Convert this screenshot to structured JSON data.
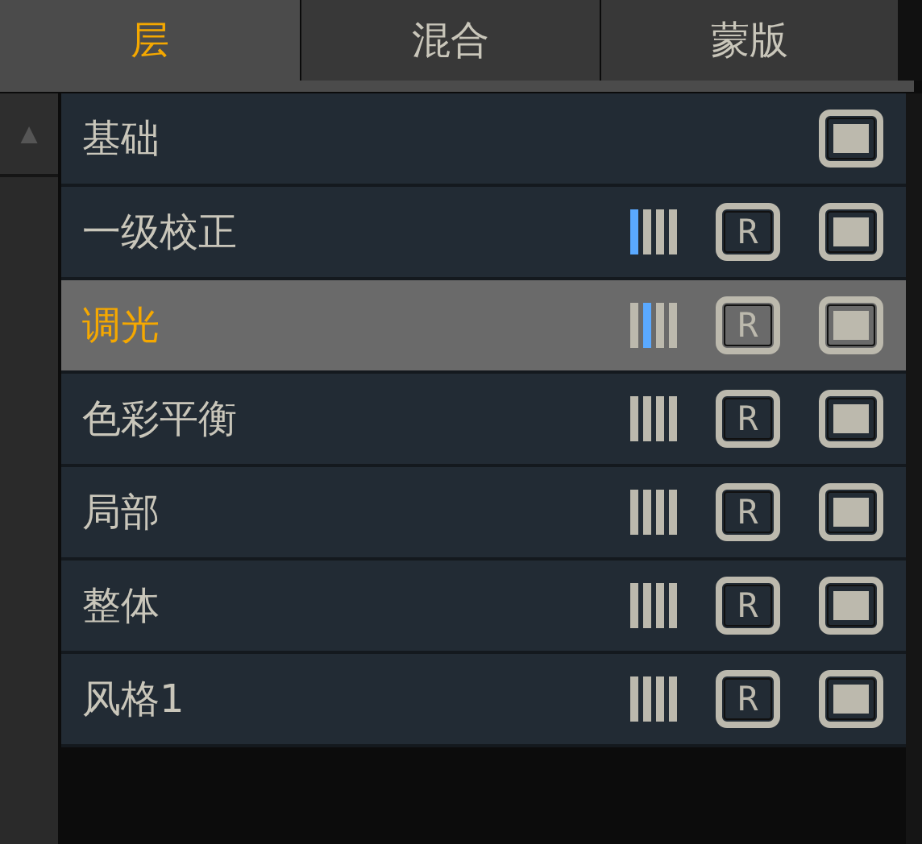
{
  "tabs": [
    {
      "label": "层",
      "selected": true
    },
    {
      "label": "混合",
      "selected": false
    },
    {
      "label": "蒙版",
      "selected": false
    }
  ],
  "scroll_up": "▲",
  "layers": [
    {
      "kind": "base",
      "name": "基础",
      "selected": false
    },
    {
      "kind": "layer",
      "name": "一级校正",
      "selected": false,
      "bars": [
        {
          "on": true
        },
        {
          "on": false
        },
        {
          "on": false
        },
        {
          "on": false
        }
      ],
      "r": "R"
    },
    {
      "kind": "layer",
      "name": "调光",
      "selected": true,
      "bars": [
        {
          "on": false
        },
        {
          "on": true
        },
        {
          "on": false
        },
        {
          "on": false
        }
      ],
      "r": "R"
    },
    {
      "kind": "layer",
      "name": "色彩平衡",
      "selected": false,
      "bars": [
        {
          "on": false
        },
        {
          "on": false
        },
        {
          "on": false
        },
        {
          "on": false
        }
      ],
      "r": "R"
    },
    {
      "kind": "layer",
      "name": "局部",
      "selected": false,
      "bars": [
        {
          "on": false
        },
        {
          "on": false
        },
        {
          "on": false
        },
        {
          "on": false
        }
      ],
      "r": "R"
    },
    {
      "kind": "layer",
      "name": "整体",
      "selected": false,
      "bars": [
        {
          "on": false
        },
        {
          "on": false
        },
        {
          "on": false
        },
        {
          "on": false
        }
      ],
      "r": "R"
    },
    {
      "kind": "layer",
      "name": "风格1",
      "selected": false,
      "bars": [
        {
          "on": false
        },
        {
          "on": false
        },
        {
          "on": false
        },
        {
          "on": false
        }
      ],
      "r": "R"
    }
  ]
}
